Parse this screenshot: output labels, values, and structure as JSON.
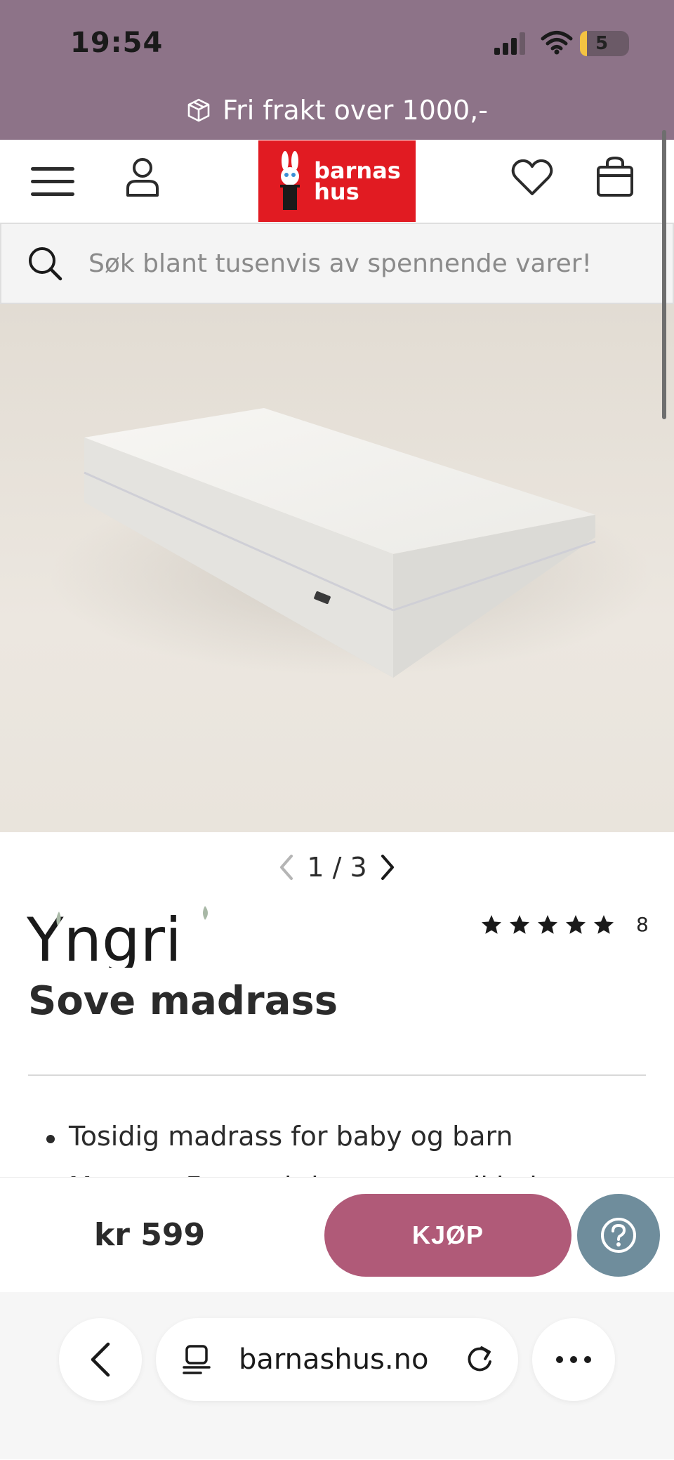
{
  "status_bar": {
    "time": "19:54",
    "battery": "5"
  },
  "promo": {
    "text": "Fri frakt over 1000,-"
  },
  "header": {
    "logo_line1": "barnas",
    "logo_line2": "hus"
  },
  "search": {
    "placeholder": "Søk blant tusenvis av spennende varer!"
  },
  "gallery": {
    "pager": "1 / 3",
    "current": 1,
    "total": 3
  },
  "product": {
    "brand": "Yngri",
    "title": "Sove madrass",
    "rating_stars": 5,
    "rating_count": "8",
    "bullets": [
      "Tosidig madrass for baby og barn",
      "Memory Foam gir jevn støtte til baby"
    ],
    "price": "kr 599",
    "buy_label": "KJØP"
  },
  "browser": {
    "url": "barnashus.no"
  },
  "colors": {
    "top_band": "#8d7388",
    "logo_red": "#e11b22",
    "buy_button": "#b05a78",
    "help_button": "#6f8d9c"
  },
  "icons": [
    "cube-icon",
    "menu-icon",
    "user-icon",
    "heart-icon",
    "bag-icon",
    "search-icon",
    "chevron-left-icon",
    "chevron-right-icon",
    "star-icon",
    "help-icon",
    "back-icon",
    "tabs-icon",
    "reload-icon",
    "more-icon"
  ]
}
